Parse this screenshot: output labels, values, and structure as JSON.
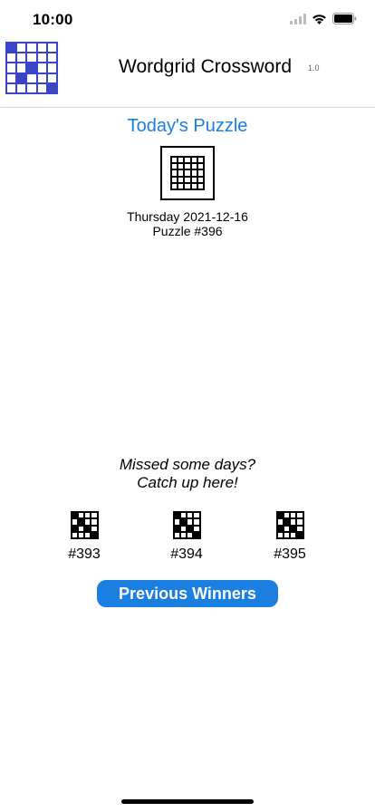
{
  "status_bar": {
    "time": "10:00"
  },
  "header": {
    "title": "Wordgrid Crossword",
    "version": "1.0",
    "accent_color": "#3a44c6"
  },
  "today": {
    "heading": "Today's Puzzle",
    "date": "Thursday 2021-12-16",
    "puzzle_number": "Puzzle #396"
  },
  "catch_up": {
    "line1": "Missed some days?",
    "line2": "Catch up here!",
    "puzzles": [
      {
        "label": "#393"
      },
      {
        "label": "#394"
      },
      {
        "label": "#395"
      }
    ]
  },
  "winners_button": {
    "label": "Previous Winners",
    "color": "#1a7fe0"
  }
}
